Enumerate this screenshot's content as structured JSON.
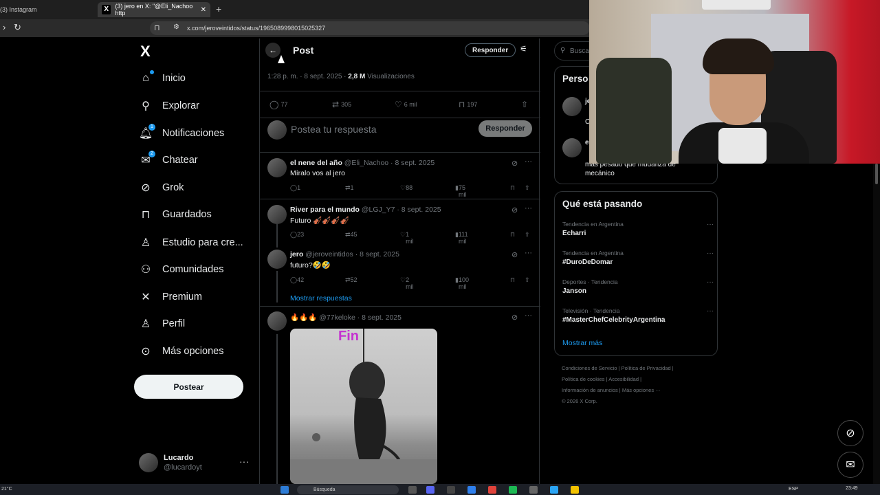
{
  "browser": {
    "tabs": [
      {
        "label": "(3) Instagram"
      },
      {
        "label": "(3) jero en X: \"@Eli_Nachoo http"
      }
    ],
    "url": "x.com/jeroveintidos/status/1965089998015025327",
    "new_tab": "+"
  },
  "sidebar": {
    "logo": "X",
    "items": [
      {
        "label": "Inicio",
        "icon": "home-icon"
      },
      {
        "label": "Explorar",
        "icon": "search-icon"
      },
      {
        "label": "Notificaciones",
        "icon": "bell-icon",
        "badge": "1"
      },
      {
        "label": "Chatear",
        "icon": "mail-icon",
        "badge": "2"
      },
      {
        "label": "Grok",
        "icon": "grok-icon"
      },
      {
        "label": "Guardados",
        "icon": "bookmark-icon"
      },
      {
        "label": "Estudio para cre...",
        "icon": "studio-icon"
      },
      {
        "label": "Comunidades",
        "icon": "communities-icon"
      },
      {
        "label": "Premium",
        "icon": "x-premium-icon"
      },
      {
        "label": "Perfil",
        "icon": "person-icon"
      },
      {
        "label": "Más opciones",
        "icon": "more-circle-icon"
      }
    ],
    "post_button": "Postear",
    "account": {
      "name": "Lucardo",
      "handle": "@lucardoyt",
      "more": "···"
    }
  },
  "post": {
    "title": "Post",
    "reply_button": "Responder",
    "time": "1:28 p. m. · 8 sept. 2025 · ",
    "views_count": "2,8 M",
    "views_label": " Visualizaciones",
    "stats": {
      "replies": "77",
      "reposts": "305",
      "likes": "6 mil",
      "bookmarks": "197"
    },
    "reply_placeholder": "Postea tu respuesta",
    "reply_submit": "Responder"
  },
  "replies": [
    {
      "name": "el nene del año",
      "handle": " @Eli_Nachoo · 8 sept. 2025",
      "text": "Míralo vos al jero",
      "replies": "1",
      "reposts": "1",
      "likes": "88",
      "views": "75 mil"
    },
    {
      "name": "River para el mundo",
      "handle": " @LGJ_Y7 · 8 sept. 2025",
      "text": "Futuro 🎻🎻🎻🎻",
      "replies": "23",
      "reposts": "45",
      "likes": "1 mil",
      "views": "111 mil"
    },
    {
      "name": "jero",
      "handle": " @jeroveintidos · 8 sept. 2025",
      "text": "futuro?🤣🤣",
      "replies": "42",
      "reposts": "52",
      "likes": "2 mil",
      "views": "100 mil"
    },
    {
      "name": "🔥🔥🔥",
      "handle": " @77keloke · 8 sept. 2025",
      "text": ""
    }
  ],
  "show_replies": "Mostrar respuestas",
  "image_caption": "Fin",
  "right": {
    "search_placeholder": "Busca",
    "who_to_follow_title": "Perso",
    "suggestion_initial_1": "je",
    "suggestion_initial_2": "C",
    "suggestion_initial_3": "e",
    "suggestion_text": "más pesado que mudanza de mecánico",
    "trends_title": "Qué está pasando",
    "trends": [
      {
        "category": "Tendencia en Argentina",
        "name": "Echarri"
      },
      {
        "category": "Tendencia en Argentina",
        "name": "#DuroDeDomar"
      },
      {
        "category": "Deportes · Tendencia",
        "name": "Janson"
      },
      {
        "category": "Televisión · Tendencia",
        "name": "#MasterChefCelebrityArgentina"
      }
    ],
    "show_more": "Mostrar más",
    "footer": {
      "l1": "Condiciones de Servicio  |  Política de Privacidad  |",
      "l2": "Política de cookies  |  Accesibilidad  |",
      "l3": "Información de anuncios  |  Más opciones ···",
      "l4": "© 2026 X Corp."
    }
  },
  "taskbar": {
    "weather": "21°C",
    "search": "Búsqueda",
    "lang": "ESP",
    "clock": "23:49"
  },
  "colors": {
    "accent": "#1d9bf0",
    "background": "#000000",
    "border": "#2f3336",
    "muted": "#71767b"
  }
}
